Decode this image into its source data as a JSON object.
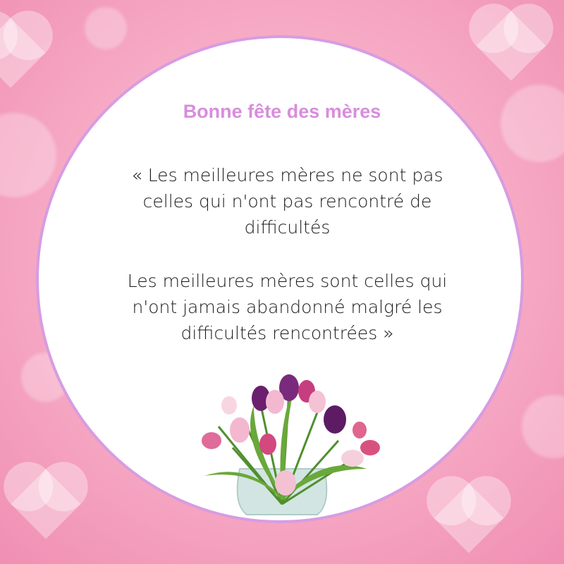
{
  "card": {
    "title": "Bonne fête des mères",
    "quote_part1": "« Les meilleures mères ne sont pas celles qui n'ont pas rencontré de difficultés",
    "quote_part2": "Les meilleures mères sont celles qui n'ont jamais abandonné malgré les difficultés rencontrées »"
  },
  "colors": {
    "title": "#d88ddd",
    "border": "#d79ce1",
    "background": "#f6a9c4"
  }
}
